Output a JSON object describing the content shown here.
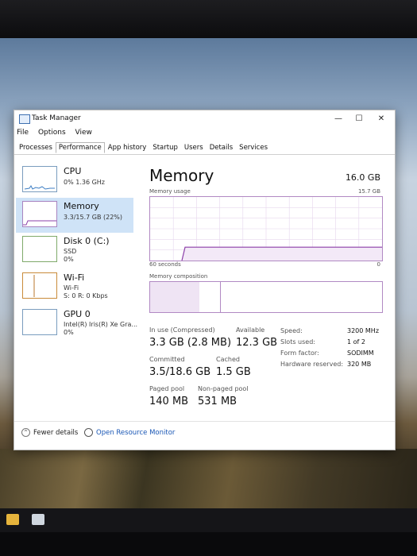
{
  "window": {
    "title": "Task Manager",
    "controls": {
      "minimize": "—",
      "maximize": "☐",
      "close": "✕"
    }
  },
  "menu": [
    "File",
    "Options",
    "View"
  ],
  "tabs": [
    "Processes",
    "Performance",
    "App history",
    "Startup",
    "Users",
    "Details",
    "Services"
  ],
  "active_tab": "Performance",
  "sidebar": [
    {
      "title": "CPU",
      "sub1": "0% 1.36 GHz",
      "sub2": "",
      "sub3": ""
    },
    {
      "title": "Memory",
      "sub1": "3.3/15.7 GB (22%)",
      "sub2": "",
      "sub3": ""
    },
    {
      "title": "Disk 0 (C:)",
      "sub1": "SSD",
      "sub2": "0%",
      "sub3": ""
    },
    {
      "title": "Wi-Fi",
      "sub1": "Wi-Fi",
      "sub2": "S: 0 R: 0 Kbps",
      "sub3": ""
    },
    {
      "title": "GPU 0",
      "sub1": "Intel(R) Iris(R) Xe Gra...",
      "sub2": "0%",
      "sub3": ""
    }
  ],
  "memory": {
    "heading": "Memory",
    "total": "16.0 GB",
    "usage_label": "Memory usage",
    "usage_max": "15.7 GB",
    "axis_left": "60 seconds",
    "axis_right": "0",
    "composition_label": "Memory composition",
    "usage_fraction": 0.21,
    "colors": {
      "line": "#8b3fa8",
      "fill": "#f3e9f7",
      "grid": "#e6d6ee",
      "border": "#b189c3"
    },
    "stats": {
      "in_use_label": "In use (Compressed)",
      "in_use_value": "3.3 GB (2.8 MB)",
      "available_label": "Available",
      "available_value": "12.3 GB",
      "committed_label": "Committed",
      "committed_value": "3.5/18.6 GB",
      "cached_label": "Cached",
      "cached_value": "1.5 GB",
      "paged_label": "Paged pool",
      "paged_value": "140 MB",
      "nonpaged_label": "Non-paged pool",
      "nonpaged_value": "531 MB"
    },
    "details": [
      {
        "label": "Speed:",
        "value": "3200 MHz"
      },
      {
        "label": "Slots used:",
        "value": "1 of 2"
      },
      {
        "label": "Form factor:",
        "value": "SODIMM"
      },
      {
        "label": "Hardware reserved:",
        "value": "320 MB"
      }
    ]
  },
  "footer": {
    "fewer_details": "Fewer details",
    "open_resource_monitor": "Open Resource Monitor"
  }
}
